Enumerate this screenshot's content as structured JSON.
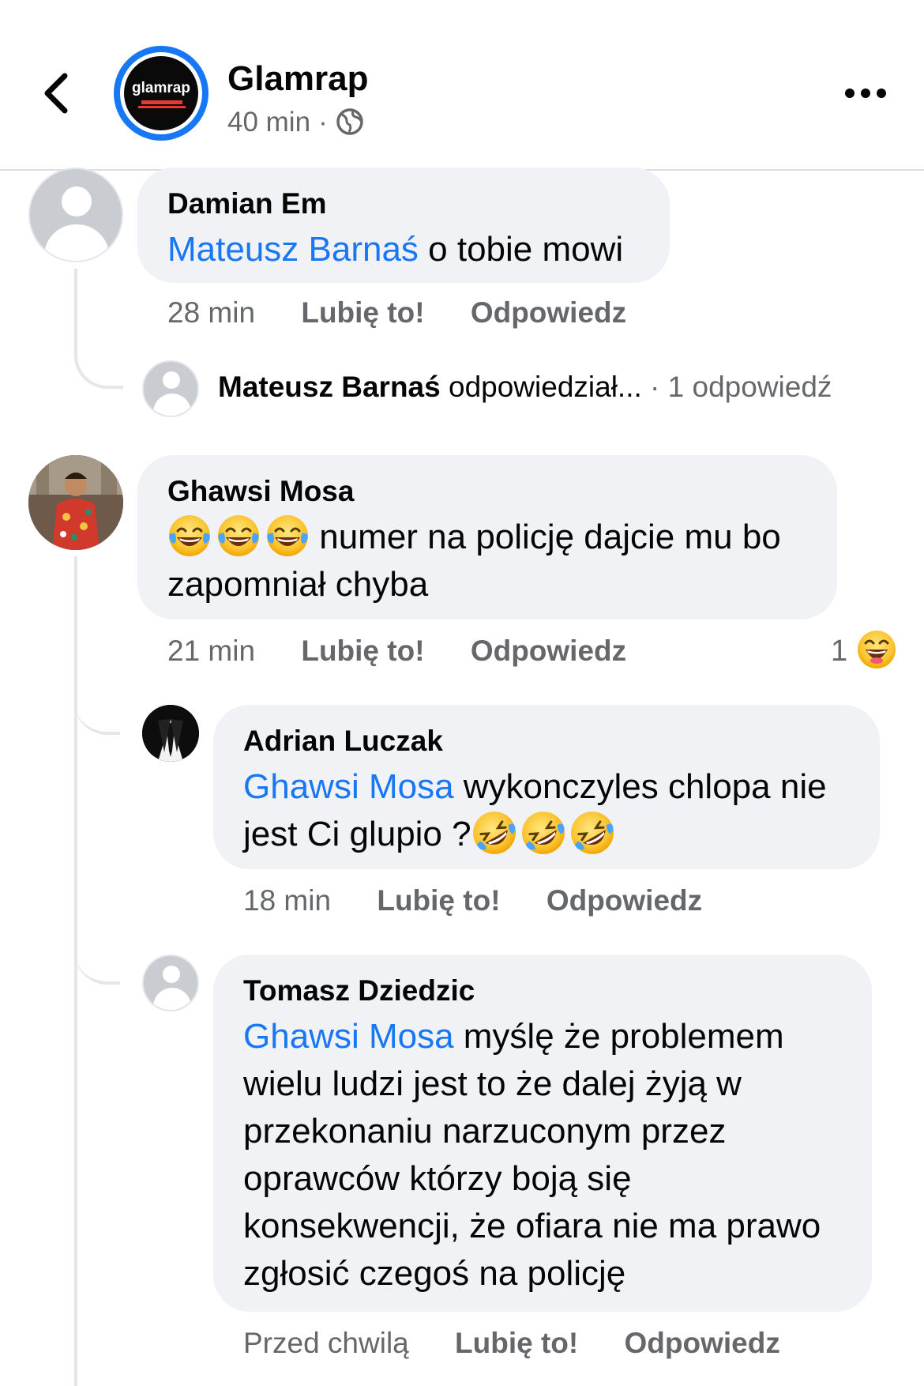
{
  "header": {
    "page_name": "Glamrap",
    "post_time": "40 min",
    "separator": "·",
    "avatar_logo": "glamrap",
    "back_icon": "chevron-left-icon",
    "visibility_icon": "globe-icon",
    "more_icon": "more-dots-icon"
  },
  "colors": {
    "mention": "#1877f2",
    "bubble": "#f0f2f5",
    "secondary_text": "#65676b",
    "thread_line": "#e4e6eb"
  },
  "comments": [
    {
      "author": "Damian Em",
      "mention": "Mateusz Barnaś",
      "text": " o tobie mowi",
      "time": "28 min",
      "like_label": "Lubię to!",
      "reply_label": "Odpowiedz",
      "reply_summary": {
        "author": "Mateusz Barnaś",
        "action": " odpowiedział...",
        "count": " · 1 odpowiedź"
      }
    },
    {
      "author": "Ghawsi Mosa",
      "emojis": [
        "face-with-tears-of-joy",
        "face-with-tears-of-joy",
        "face-with-tears-of-joy"
      ],
      "text": " numer na policję dajcie mu bo zapomniał chyba",
      "time": "21 min",
      "like_label": "Lubię to!",
      "reply_label": "Odpowiedz",
      "reaction_count": "1",
      "reaction_icon": "haha-reaction-icon",
      "replies": [
        {
          "author": "Adrian Luczak",
          "mention": "Ghawsi Mosa",
          "text_line1": " wykonczyles chlopa nie",
          "text_line2": "jest Ci glupio ?",
          "emojis": [
            "rolling-on-floor-laughing",
            "rolling-on-floor-laughing",
            "rolling-on-floor-laughing"
          ],
          "time": "18 min",
          "like_label": "Lubię to!",
          "reply_label": "Odpowiedz"
        },
        {
          "author": "Tomasz Dziedzic",
          "mention": "Ghawsi Mosa",
          "text_lines": [
            " myślę że problemem",
            "wielu ludzi jest to że dalej żyją w",
            "przekonaniu narzuconym przez",
            "oprawców którzy boją się",
            "konsekwencji, że ofiara nie ma prawo",
            "zgłosić czegoś na policję"
          ],
          "time": "Przed chwilą",
          "like_label": "Lubię to!",
          "reply_label": "Odpowiedz"
        }
      ]
    }
  ]
}
